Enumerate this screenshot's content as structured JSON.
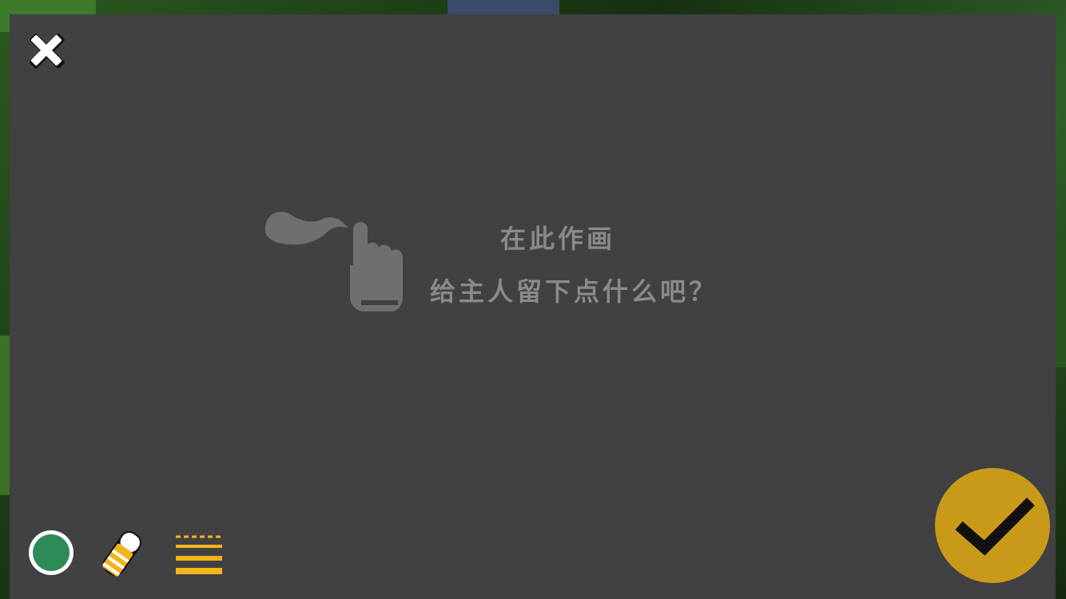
{
  "scene": {
    "panel_color": "#414042",
    "background_color": "#1f3a1a"
  },
  "toolbar": {
    "close_icon": "close-x-icon",
    "confirm_icon": "checkmark-icon",
    "confirm_color": "#c99a1a",
    "tools": [
      {
        "name": "color-picker",
        "icon": "color-circle-icon",
        "color": "#2e8b57"
      },
      {
        "name": "eraser",
        "icon": "eraser-icon",
        "color": "#f2b418"
      },
      {
        "name": "brush-size",
        "icon": "line-weight-icon",
        "color": "#f2b418"
      }
    ]
  },
  "hint": {
    "icon": "pointing-hand-icon",
    "line1": "在此作画",
    "line2": "给主人留下点什么吧？",
    "text_color": "#8a8a8a"
  }
}
